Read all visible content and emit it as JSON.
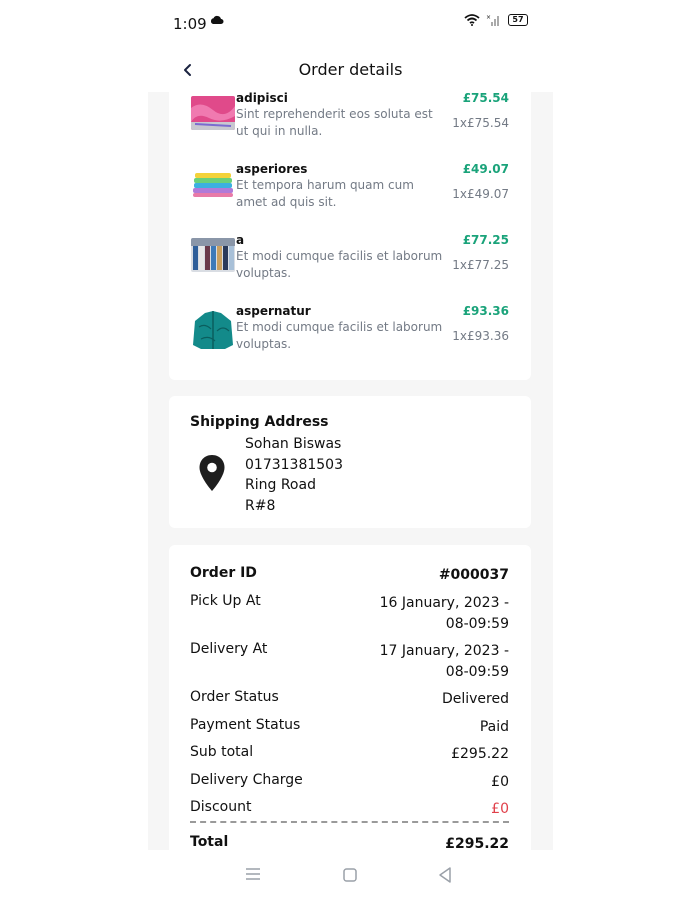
{
  "status_bar": {
    "time": "1:09",
    "battery": "57"
  },
  "header": {
    "title": "Order details"
  },
  "items": [
    {
      "name": "adipisci",
      "description": "Sint reprehenderit eos soluta est ut qui in nulla.",
      "price": "£75.54",
      "qty": "1x£75.54",
      "thumb": "fabric-pink"
    },
    {
      "name": "asperiores",
      "description": "Et tempora harum quam cum amet ad quis sit.",
      "price": "£49.07",
      "qty": "1x£49.07",
      "thumb": "towels-stack"
    },
    {
      "name": "a",
      "description": "Et modi cumque facilis et laborum voluptas.",
      "price": "£77.25",
      "qty": "1x£77.25",
      "thumb": "clothes-rack"
    },
    {
      "name": "aspernatur",
      "description": "Et modi cumque facilis et laborum voluptas.",
      "price": "£93.36",
      "qty": "1x£93.36",
      "thumb": "teal-jacket"
    }
  ],
  "shipping": {
    "title": "Shipping Address",
    "name": "Sohan Biswas",
    "phone": "01731381503",
    "street": "Ring Road",
    "extra": "R#8"
  },
  "summary": {
    "order_id_label": "Order ID",
    "order_id": "#000037",
    "pickup_label": "Pick Up At",
    "pickup_date": "16 January, 2023 -",
    "pickup_time": "08-09:59",
    "delivery_label": "Delivery At",
    "delivery_date": "17 January, 2023 -",
    "delivery_time": "08-09:59",
    "status_label": "Order Status",
    "status": "Delivered",
    "payment_label": "Payment Status",
    "payment": "Paid",
    "subtotal_label": "Sub total",
    "subtotal": "£295.22",
    "delivery_charge_label": "Delivery Charge",
    "delivery_charge": "£0",
    "discount_label": "Discount",
    "discount": "£0",
    "total_label": "Total",
    "total": "£295.22"
  },
  "colors": {
    "accent_green": "#1aa37a",
    "discount_red": "#e0404a",
    "muted_text": "#737a85"
  }
}
